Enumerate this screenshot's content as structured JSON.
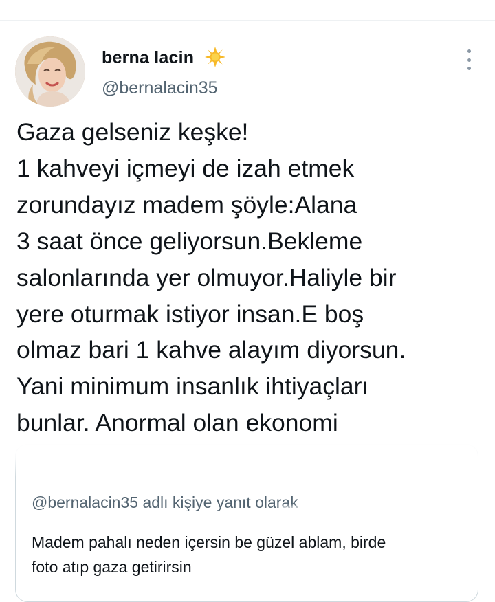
{
  "tweet": {
    "author": {
      "display_name": "berna lacin",
      "handle": "@bernalacin35",
      "badge_icon": "sun-emoji-icon",
      "badge_color": "#f7b928"
    },
    "menu_icon": "more-vertical-icon",
    "text_lines": [
      "Gaza gelseniz keşke!",
      "1 kahveyi içmeyi de izah etmek",
      "zorundayız madem şöyle:Alana",
      "3 saat önce geliyorsun.Bekleme",
      "salonlarında yer olmuyor.Haliyle bir",
      "yere oturmak istiyor insan.E boş",
      "olmaz bari 1 kahve alayım diyorsun.",
      "Yani minimum insanlık ihtiyaçları",
      "bunlar. Anormal olan ekonomi"
    ]
  },
  "quoted_reply": {
    "reply_to_text": "@bernalacin35 adlı kişiye yanıt olarak",
    "text_lines": [
      "Madem pahalı neden içersin be güzel ablam, birde",
      "foto atıp gaza getirirsin"
    ]
  },
  "colors": {
    "text_primary": "#0f1419",
    "text_secondary": "#536471",
    "border": "#cfd9de"
  }
}
